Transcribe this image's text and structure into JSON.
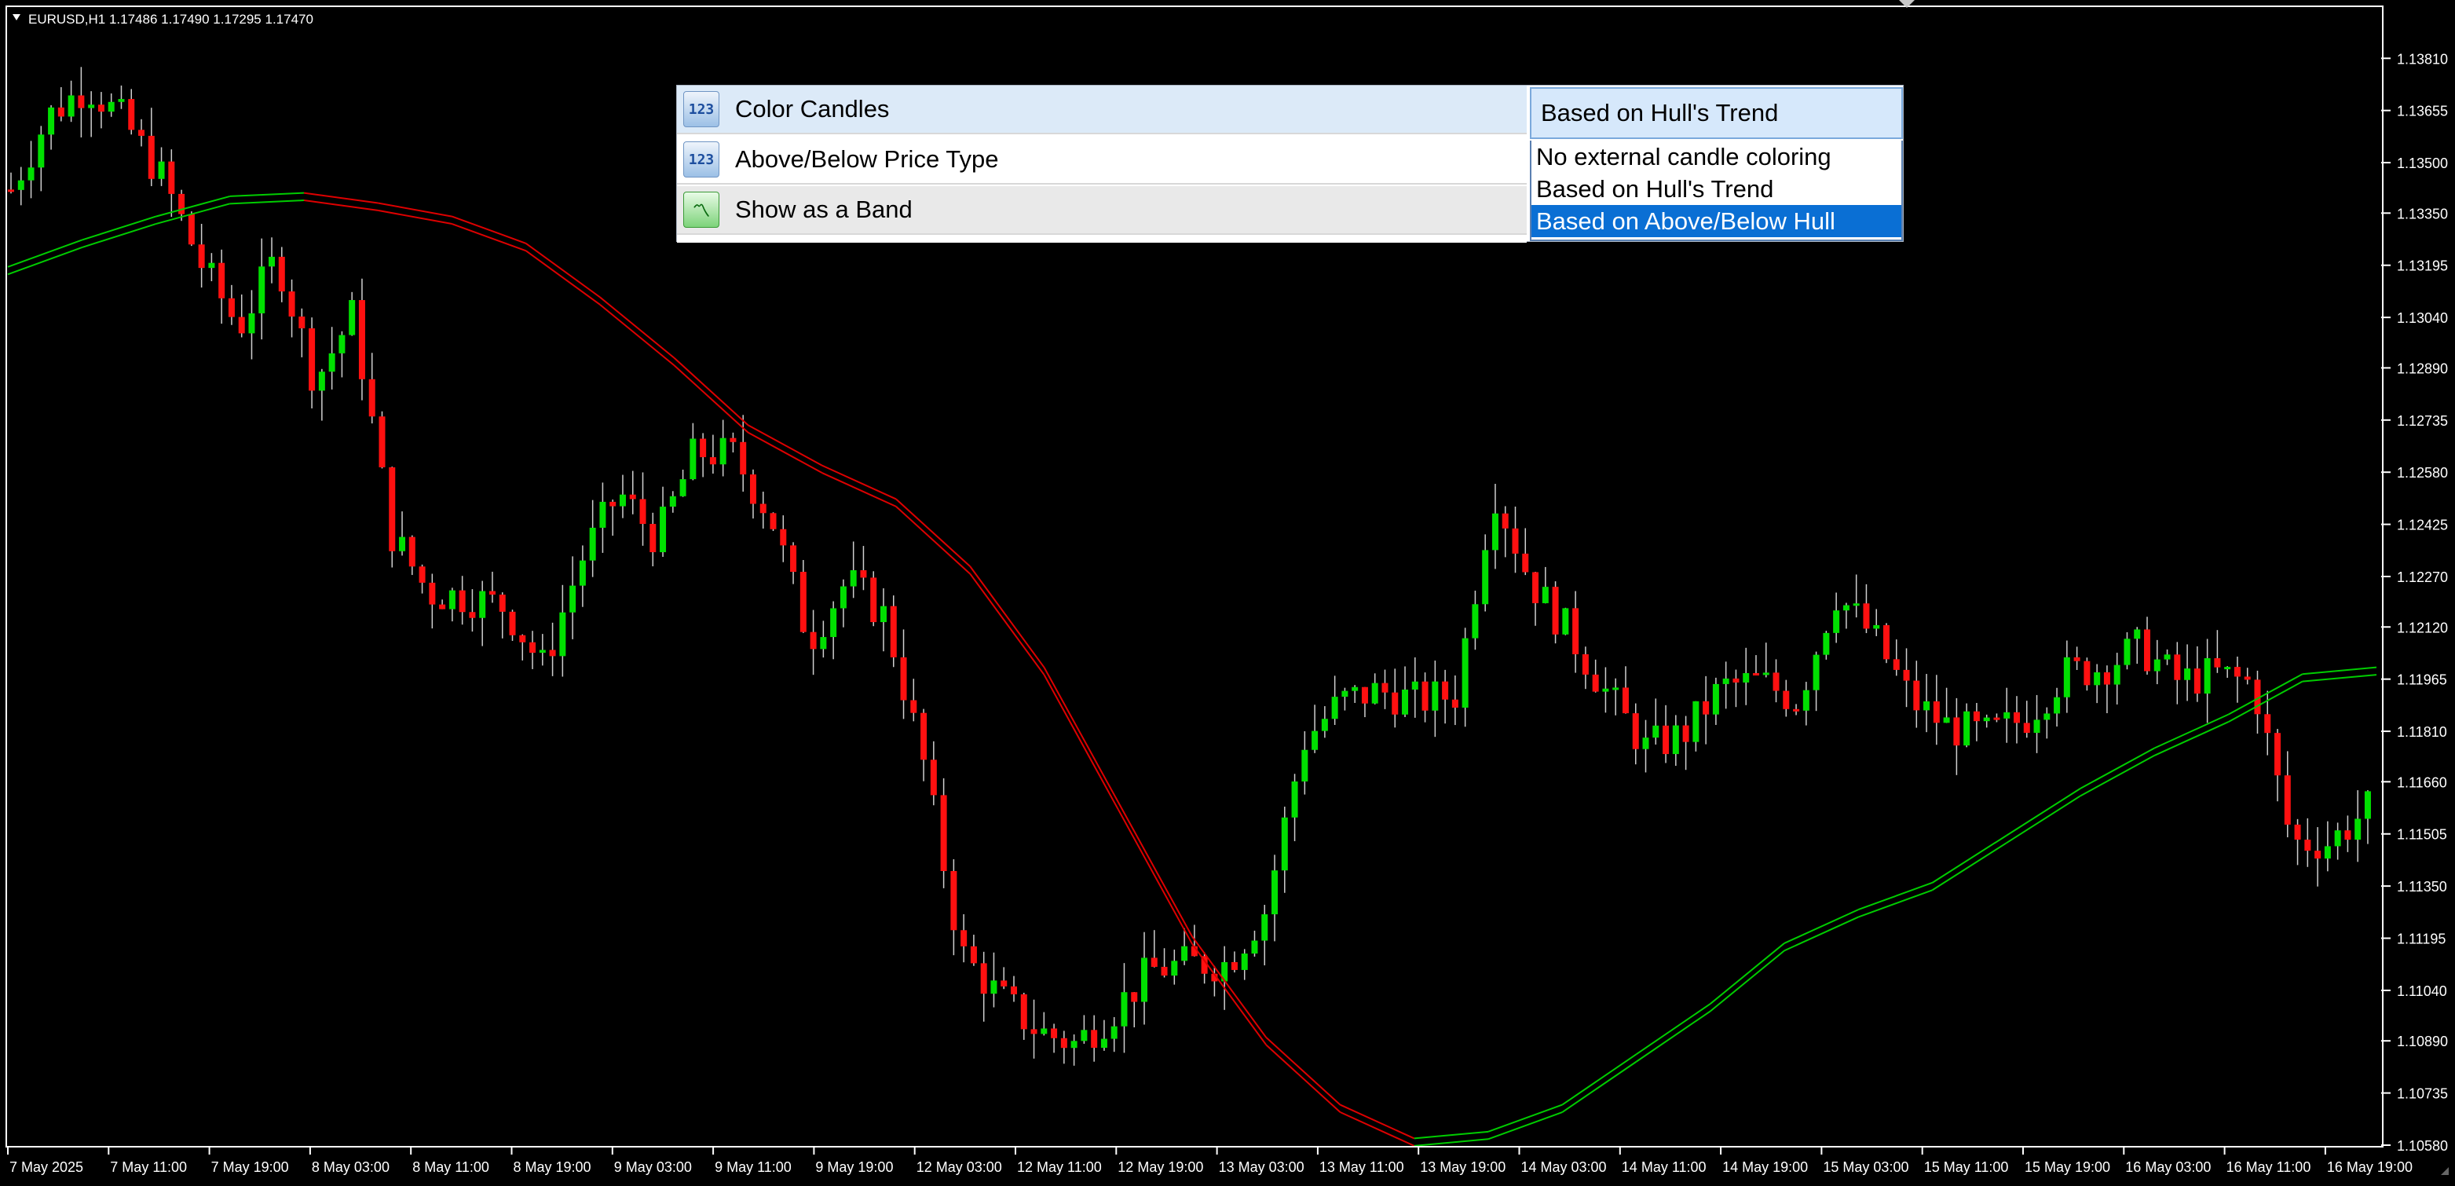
{
  "window": {
    "symbol_info": "EURUSD,H1  1.17486 1.17490 1.17295 1.17470"
  },
  "colors": {
    "background": "#000000",
    "bull": "#00e000",
    "bear": "#ff1010",
    "hull_up": "#00cc00",
    "hull_down": "#dd0000",
    "axis": "#ffffff",
    "dropdown_selected": "#0a6fd4"
  },
  "properties_panel": {
    "rows": [
      {
        "icon": "number-123-icon",
        "label": "Color Candles"
      },
      {
        "icon": "number-123-icon",
        "label": "Above/Below Price Type"
      },
      {
        "icon": "band-chart-icon",
        "label": "Show as a Band"
      }
    ],
    "combo_value": "Based on Hull's Trend",
    "options": [
      "No external candle coloring",
      "Based on Hull's Trend",
      "Based on Above/Below Hull"
    ],
    "selected_index": 2
  },
  "chart_data": {
    "type": "candlestick",
    "title": "EURUSD,H1",
    "y_range": [
      1.1058,
      1.1396
    ],
    "y_ticks": [
      "1.13810",
      "1.13655",
      "1.13500",
      "1.13350",
      "1.13195",
      "1.13040",
      "1.12890",
      "1.12735",
      "1.12580",
      "1.12425",
      "1.12270",
      "1.12120",
      "1.11965",
      "1.11810",
      "1.11660",
      "1.11505",
      "1.11350",
      "1.11195",
      "1.11040",
      "1.10890",
      "1.10735",
      "1.10580"
    ],
    "x_ticks": [
      "7 May 2025",
      "7 May 11:00",
      "7 May 19:00",
      "8 May 03:00",
      "8 May 11:00",
      "8 May 19:00",
      "9 May 03:00",
      "9 May 11:00",
      "9 May 19:00",
      "12 May 03:00",
      "12 May 11:00",
      "12 May 19:00",
      "13 May 03:00",
      "13 May 11:00",
      "13 May 19:00",
      "14 May 03:00",
      "14 May 11:00",
      "14 May 19:00",
      "15 May 03:00",
      "15 May 11:00",
      "15 May 19:00",
      "16 May 03:00",
      "16 May 11:00",
      "16 May 19:00"
    ],
    "close_path": [
      1.1342,
      1.1364,
      1.1373,
      1.1362,
      1.1345,
      1.132,
      1.1301,
      1.1322,
      1.1285,
      1.1305,
      1.124,
      1.1222,
      1.1221,
      1.1218,
      1.12,
      1.1232,
      1.1252,
      1.1238,
      1.1264,
      1.1263,
      1.1245,
      1.1208,
      1.1226,
      1.1215,
      1.1172,
      1.1115,
      1.1102,
      1.1092,
      1.1088,
      1.1098,
      1.111,
      1.1112,
      1.1112,
      1.1128,
      1.1178,
      1.119,
      1.1193,
      1.119,
      1.1192,
      1.1253,
      1.1225,
      1.121,
      1.1192,
      1.1176,
      1.118,
      1.1194,
      1.1196,
      1.119,
      1.1222,
      1.1209,
      1.119,
      1.1182,
      1.118,
      1.1185,
      1.1198,
      1.12,
      1.1206,
      1.1196,
      1.1198,
      1.1195,
      1.1148,
      1.1148,
      1.1158
    ],
    "hull_path": [
      1.1319,
      1.1327,
      1.1334,
      1.134,
      1.1341,
      1.1338,
      1.1334,
      1.1326,
      1.131,
      1.1292,
      1.1272,
      1.126,
      1.125,
      1.123,
      1.12,
      1.116,
      1.112,
      1.109,
      1.107,
      1.106,
      1.1062,
      1.107,
      1.1085,
      1.11,
      1.1118,
      1.1128,
      1.1136,
      1.115,
      1.1164,
      1.1176,
      1.1186,
      1.1198,
      1.12
    ],
    "hull_trend_flips": [
      "down after 7 May 19:00",
      "up after 13 May 19:00",
      "down near 16 May 11:00"
    ]
  }
}
